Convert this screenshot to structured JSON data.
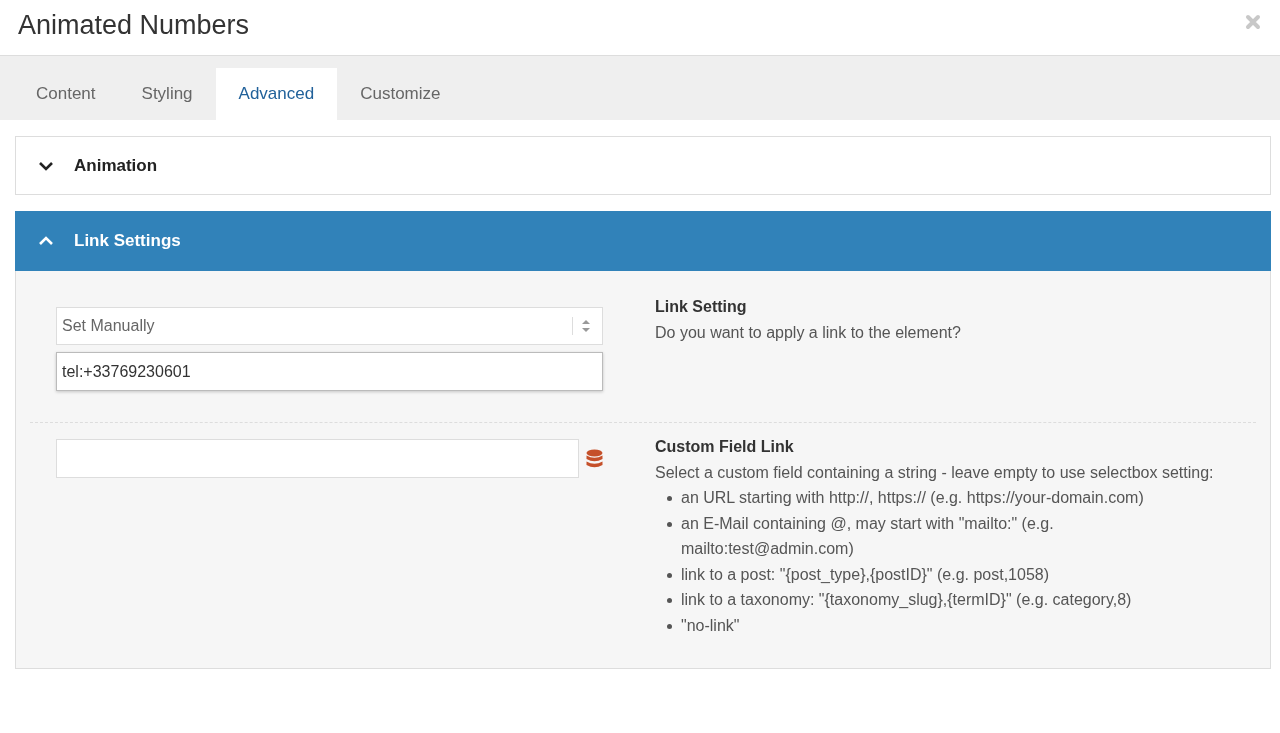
{
  "window": {
    "title": "Animated Numbers"
  },
  "tabs": [
    {
      "label": "Content",
      "selected": false
    },
    {
      "label": "Styling",
      "selected": false
    },
    {
      "label": "Advanced",
      "selected": true
    },
    {
      "label": "Customize",
      "selected": false
    }
  ],
  "sections": [
    {
      "title": "Animation",
      "expanded": false
    },
    {
      "title": "Link Settings",
      "expanded": true,
      "settings": [
        {
          "kind": "select",
          "value": "Set Manually",
          "input_value": "tel:+33769230601",
          "label": "Link Setting",
          "description": "Do you want to apply a link to the element?"
        },
        {
          "kind": "custom_field",
          "label": "Custom Field Link",
          "description": "Select a custom field containing a string - leave empty to use selectbox setting:",
          "bullets": [
            "an URL starting with http://, https:// (e.g. https://your-domain.com)",
            "an E-Mail containing @, may start with \"mailto:\" (e.g. mailto:test@admin.com)",
            "link to a post: \"{post_type},{postID}\" (e.g. post,1058)",
            "link to a taxonomy: \"{taxonomy_slug},{termID}\" (e.g. category,8)",
            "\"no-link\""
          ]
        }
      ]
    }
  ]
}
